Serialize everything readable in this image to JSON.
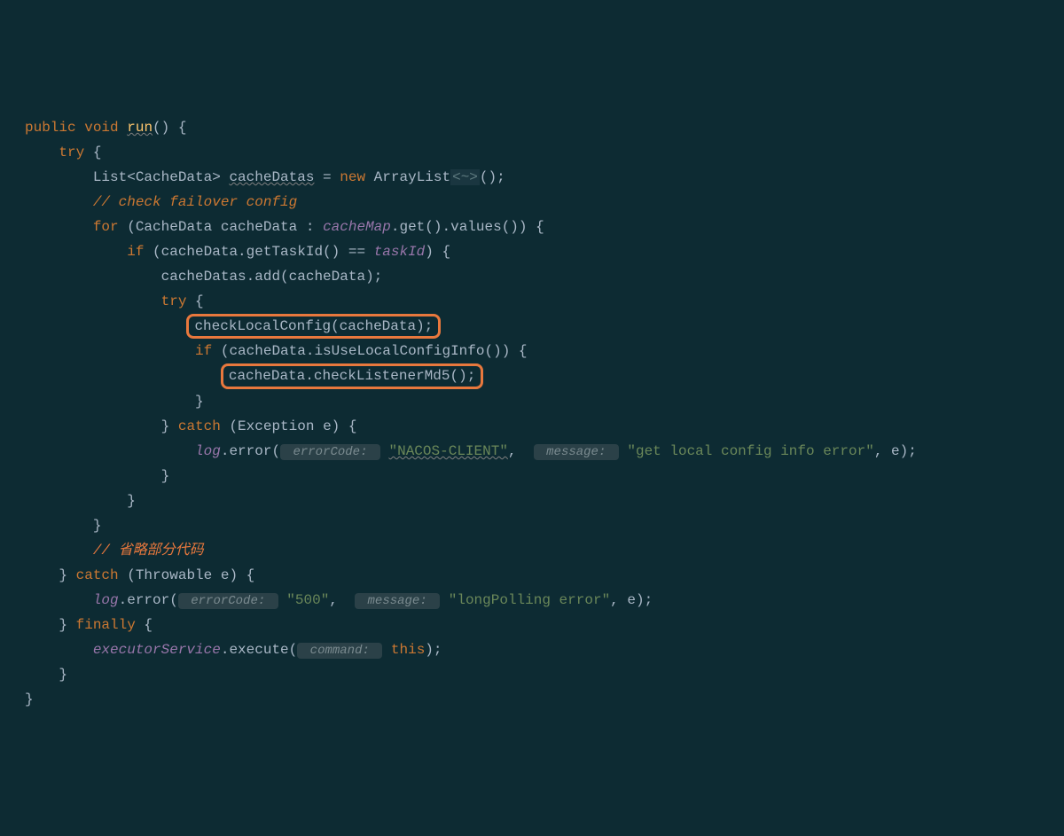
{
  "code": {
    "l1_public": "public",
    "l1_void": "void",
    "l1_run": "run",
    "l1_rest": "() {",
    "l2_try": "try",
    "l2_brace": " {",
    "l3_list": "List<CacheData> ",
    "l3_var": "cacheDatas",
    "l3_eq": " = ",
    "l3_new": "new",
    "l3_arraylist": " ArrayList",
    "l3_diamond": "<~>",
    "l3_end": "();",
    "l4_comment": "// check failover config",
    "l5_for": "for",
    "l5_rest": " (CacheData cacheData : ",
    "l5_cachemap": "cacheMap",
    "l5_getvalues": ".get().values()) {",
    "l6_if": "if",
    "l6_open": " (cacheData.getTaskId() == ",
    "l6_taskid": "taskId",
    "l6_close": ") {",
    "l7_add": "cacheDatas.add(cacheData);",
    "l8_try": "try",
    "l8_brace": " {",
    "l9_box": "checkLocalConfig(cacheData);",
    "l10_if": "if",
    "l10_rest": " (cacheData.isUseLocalConfigInfo()) {",
    "l11_box": "cacheData.checkListenerMd5();",
    "l12_close": "}",
    "l13_catch_close": "}",
    "l13_catch": " catch",
    "l13_exc": " (Exception e) {",
    "l14_log": "log",
    "l14_error": ".error(",
    "l14_hint1": " errorCode: ",
    "l14_str1": "\"NACOS-CLIENT\"",
    "l14_comma": ", ",
    "l14_hint2": " message: ",
    "l14_str2": "\"get local config info error\"",
    "l14_end": ", e);",
    "l15_close": "}",
    "l16_close": "}",
    "l17_close": "}",
    "l18_comment": "// 省略部分代码",
    "l19_close": "}",
    "l19_catch": " catch",
    "l19_thr": " (Throwable e) {",
    "l20_log": "log",
    "l20_error": ".error(",
    "l20_hint1": " errorCode: ",
    "l20_str1": "\"500\"",
    "l20_comma": ", ",
    "l20_hint2": " message: ",
    "l20_str2": "\"longPolling error\"",
    "l20_end": ", e);",
    "l21_close": "}",
    "l21_finally": " finally",
    "l21_brace": " {",
    "l22_exec": "executorService",
    "l22_execute": ".execute(",
    "l22_hint": " command: ",
    "l22_this": "this",
    "l22_end": ");",
    "l23_close": "}",
    "l24_close": "}"
  },
  "highlight_boxes": [
    "checkLocalConfig(cacheData);",
    "cacheData.checkListenerMd5();"
  ]
}
